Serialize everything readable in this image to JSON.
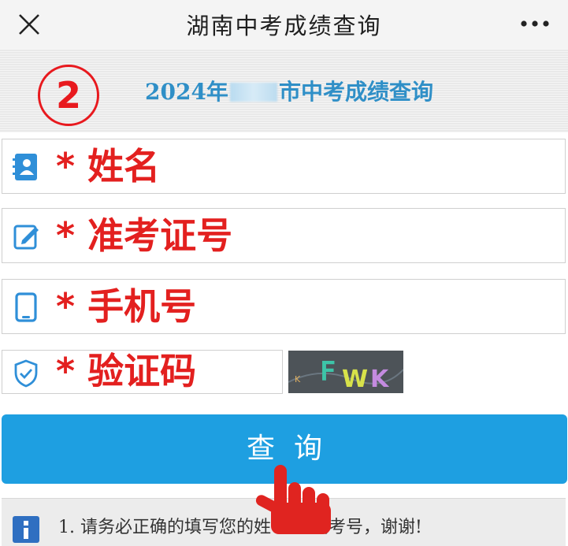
{
  "nav": {
    "title": "湖南中考成绩查询",
    "close_icon": "close-icon",
    "more_icon": "more-icon"
  },
  "banner": {
    "step": "2",
    "title_prefix": "2024年",
    "title_suffix": "市中考成绩查询"
  },
  "form": {
    "fields": [
      {
        "label": "* 姓名",
        "icon": "contact-card-icon"
      },
      {
        "label": "* 准考证号",
        "icon": "edit-icon"
      },
      {
        "label": "* 手机号",
        "icon": "phone-icon"
      },
      {
        "label": "* 验证码",
        "icon": "shield-icon"
      }
    ],
    "captcha_text": "KFWK",
    "submit_label": "查询"
  },
  "notice": {
    "icon": "info-icon",
    "text": "1. 请务必正确的填写您的姓          证号或考号，谢谢!"
  },
  "colors": {
    "accent": "#1e9fe1",
    "label_red": "#e3201f",
    "banner_title": "#2f8fc7",
    "icon_blue": "#2f8fd8"
  }
}
